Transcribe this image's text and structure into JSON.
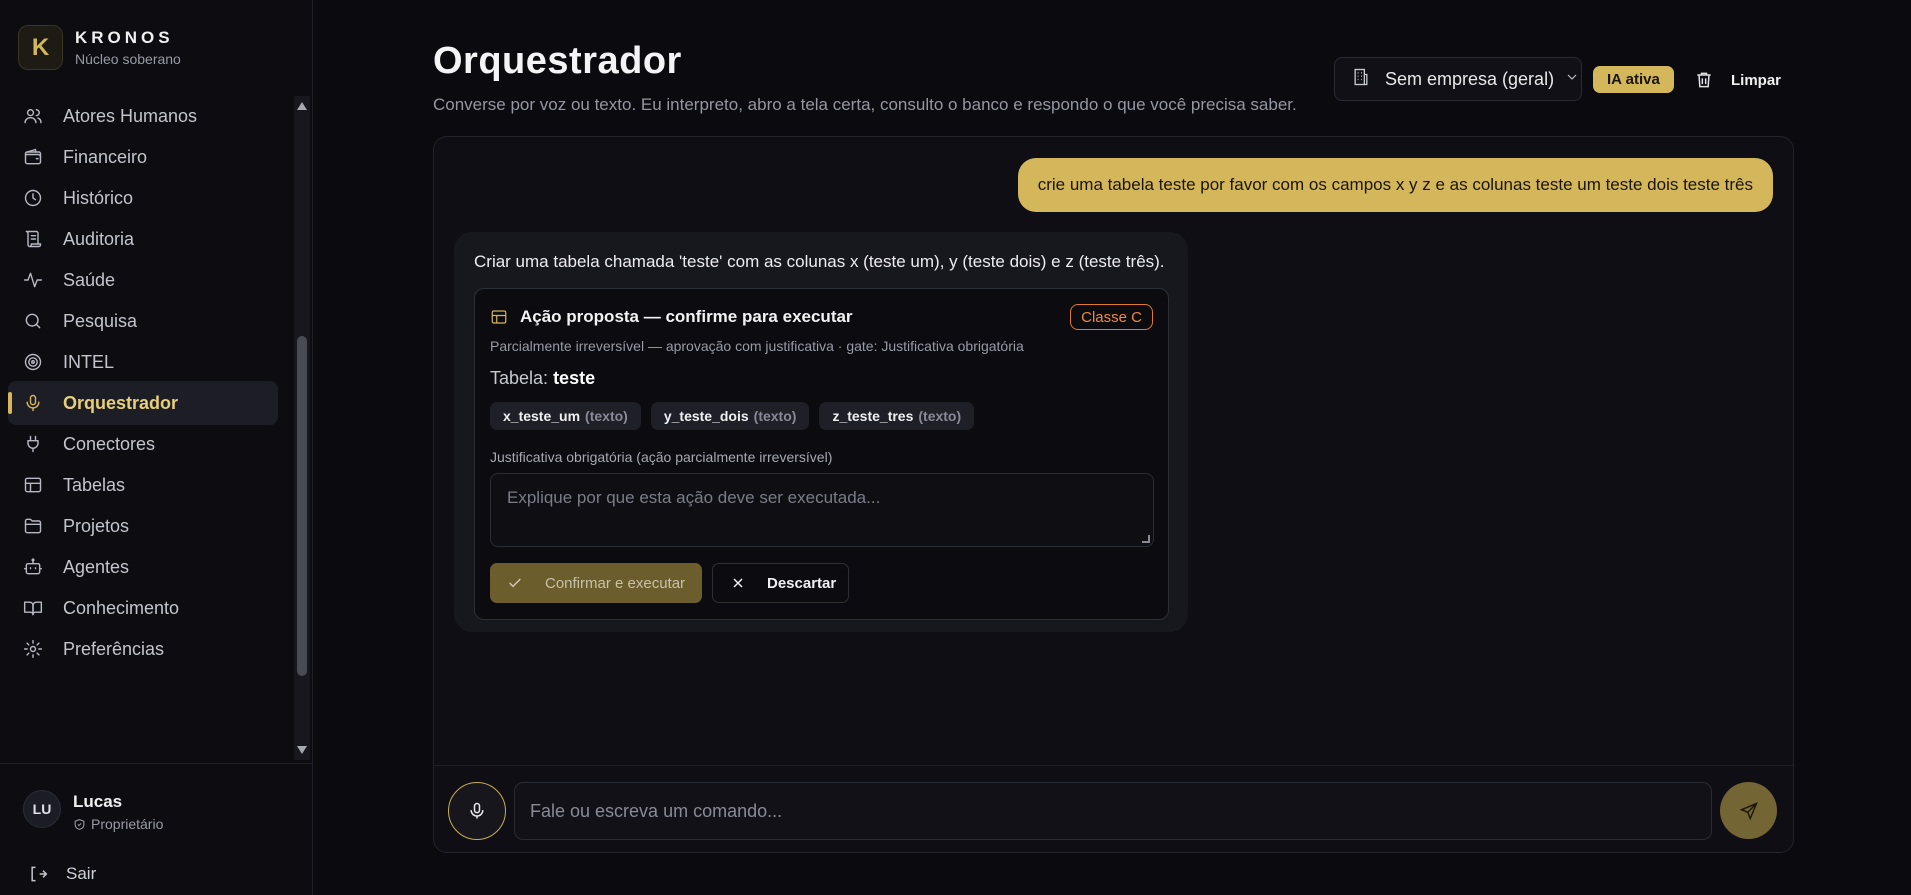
{
  "brand": {
    "logo_letter": "K",
    "name": "KRONOS",
    "subtitle": "Núcleo soberano"
  },
  "sidebar": {
    "items": [
      {
        "label": "Atores Humanos",
        "icon": "users-icon"
      },
      {
        "label": "Financeiro",
        "icon": "wallet-icon"
      },
      {
        "label": "Histórico",
        "icon": "clock-icon"
      },
      {
        "label": "Auditoria",
        "icon": "scroll-icon"
      },
      {
        "label": "Saúde",
        "icon": "activity-icon"
      },
      {
        "label": "Pesquisa",
        "icon": "search-icon"
      },
      {
        "label": "INTEL",
        "icon": "brain-icon"
      },
      {
        "label": "Orquestrador",
        "icon": "mic-icon",
        "active": true
      },
      {
        "label": "Conectores",
        "icon": "plug-icon"
      },
      {
        "label": "Tabelas",
        "icon": "table-icon"
      },
      {
        "label": "Projetos",
        "icon": "folder-icon"
      },
      {
        "label": "Agentes",
        "icon": "bot-icon"
      },
      {
        "label": "Conhecimento",
        "icon": "book-icon"
      },
      {
        "label": "Preferências",
        "icon": "settings-icon"
      }
    ]
  },
  "user": {
    "initials": "LU",
    "name": "Lucas",
    "role": "Proprietário",
    "logout_label": "Sair"
  },
  "header": {
    "title": "Orquestrador",
    "description": "Converse por voz ou texto. Eu interpreto, abro a tela certa, consulto o banco e respondo o que você precisa saber.",
    "company_select": "Sem empresa (geral)",
    "ia_badge": "IA ativa",
    "clear_label": "Limpar"
  },
  "chat": {
    "user_message": "crie uma tabela teste por favor com os campos x y z e as colunas teste um teste dois teste três",
    "bot_message": "Criar uma tabela chamada 'teste' com as colunas x (teste um), y (teste dois) e z (teste três).",
    "action": {
      "title": "Ação proposta — confirme para executar",
      "class_badge": "Classe C",
      "subtitle": "Parcialmente irreversível — aprovação com justificativa · gate: Justificativa obrigatória",
      "table_label": "Tabela:",
      "table_name": "teste",
      "columns": [
        {
          "name": "x_teste_um",
          "type": "(texto)"
        },
        {
          "name": "y_teste_dois",
          "type": "(texto)"
        },
        {
          "name": "z_teste_tres",
          "type": "(texto)"
        }
      ],
      "justification_label": "Justificativa obrigatória (ação parcialmente irreversível)",
      "justification_placeholder": "Explique por que esta ação deve ser executada...",
      "confirm_label": "Confirmar e executar",
      "discard_label": "Descartar"
    }
  },
  "composer": {
    "placeholder": "Fale ou escreva um comando..."
  },
  "colors": {
    "accent": "#d4b75a",
    "background": "#0a0a0f",
    "class_badge": "#e07a2e"
  }
}
